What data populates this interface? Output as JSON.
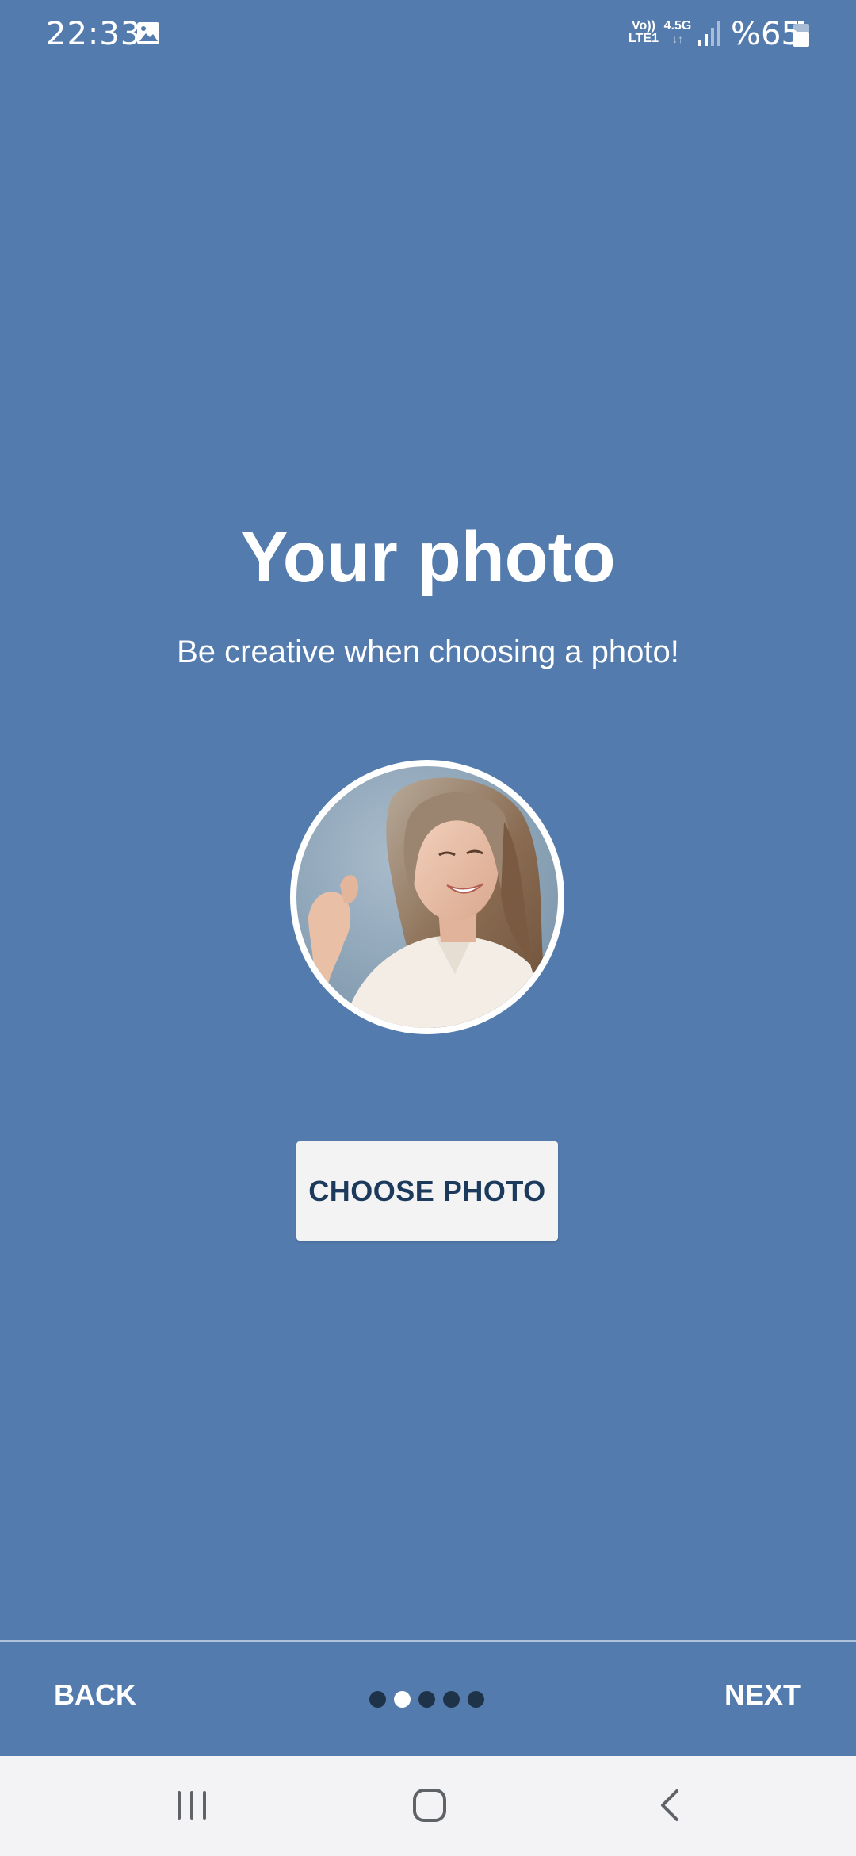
{
  "status_bar": {
    "time": "22:33",
    "volte_label_top": "Vo))",
    "volte_label_bottom": "LTE1",
    "network_label": "4.5G",
    "network_arrows": "↓↑",
    "battery_text": "%65",
    "icons": [
      "gallery-notification-icon",
      "signal-icon",
      "battery-icon"
    ]
  },
  "main": {
    "title": "Your photo",
    "subtitle": "Be creative when choosing a photo!",
    "choose_button_label": "CHOOSE PHOTO"
  },
  "bottom_nav": {
    "back_label": "BACK",
    "next_label": "NEXT",
    "page_count": 5,
    "active_page": 2
  },
  "system_nav": {
    "icons": [
      "recents-icon",
      "home-icon",
      "back-icon"
    ]
  },
  "colors": {
    "background": "#537bad",
    "button_bg": "#f3f3f4",
    "button_text": "#1c3a5c",
    "dot_inactive": "#1f3348",
    "dot_active": "#ffffff",
    "system_nav_bg": "#f3f3f5"
  }
}
